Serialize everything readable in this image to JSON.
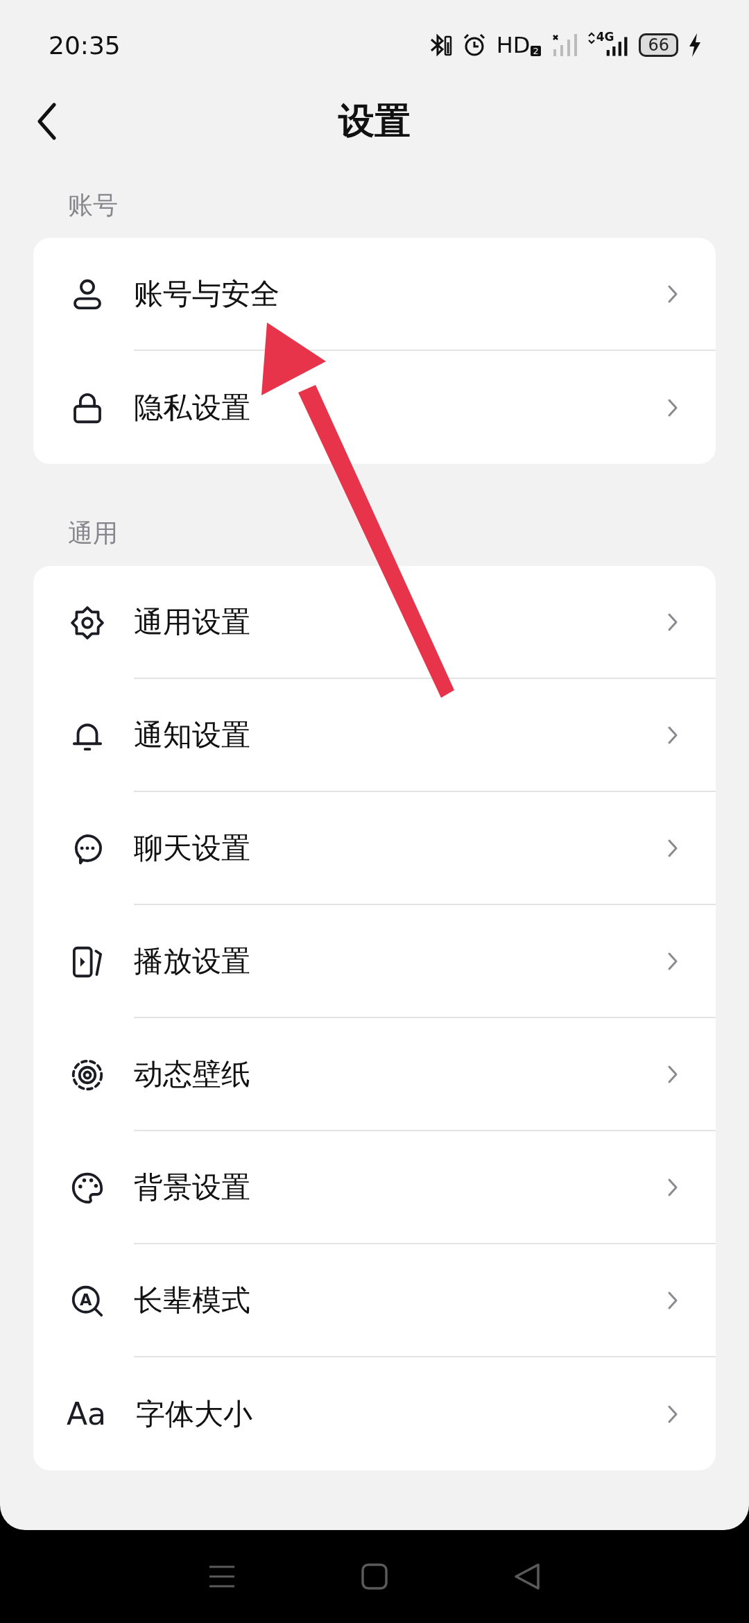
{
  "status_bar": {
    "time": "20:35",
    "hd": "HD",
    "hd_sim": "2",
    "network": "4G",
    "battery": "66"
  },
  "header": {
    "title": "设置"
  },
  "sections": [
    {
      "title": "账号",
      "items": [
        {
          "label": "账号与安全"
        },
        {
          "label": "隐私设置"
        }
      ]
    },
    {
      "title": "通用",
      "items": [
        {
          "label": "通用设置"
        },
        {
          "label": "通知设置"
        },
        {
          "label": "聊天设置"
        },
        {
          "label": "播放设置"
        },
        {
          "label": "动态壁纸"
        },
        {
          "label": "背景设置"
        },
        {
          "label": "长辈模式",
          "icon_text": "A"
        },
        {
          "label": "字体大小",
          "icon_text": "Aa"
        }
      ]
    }
  ]
}
